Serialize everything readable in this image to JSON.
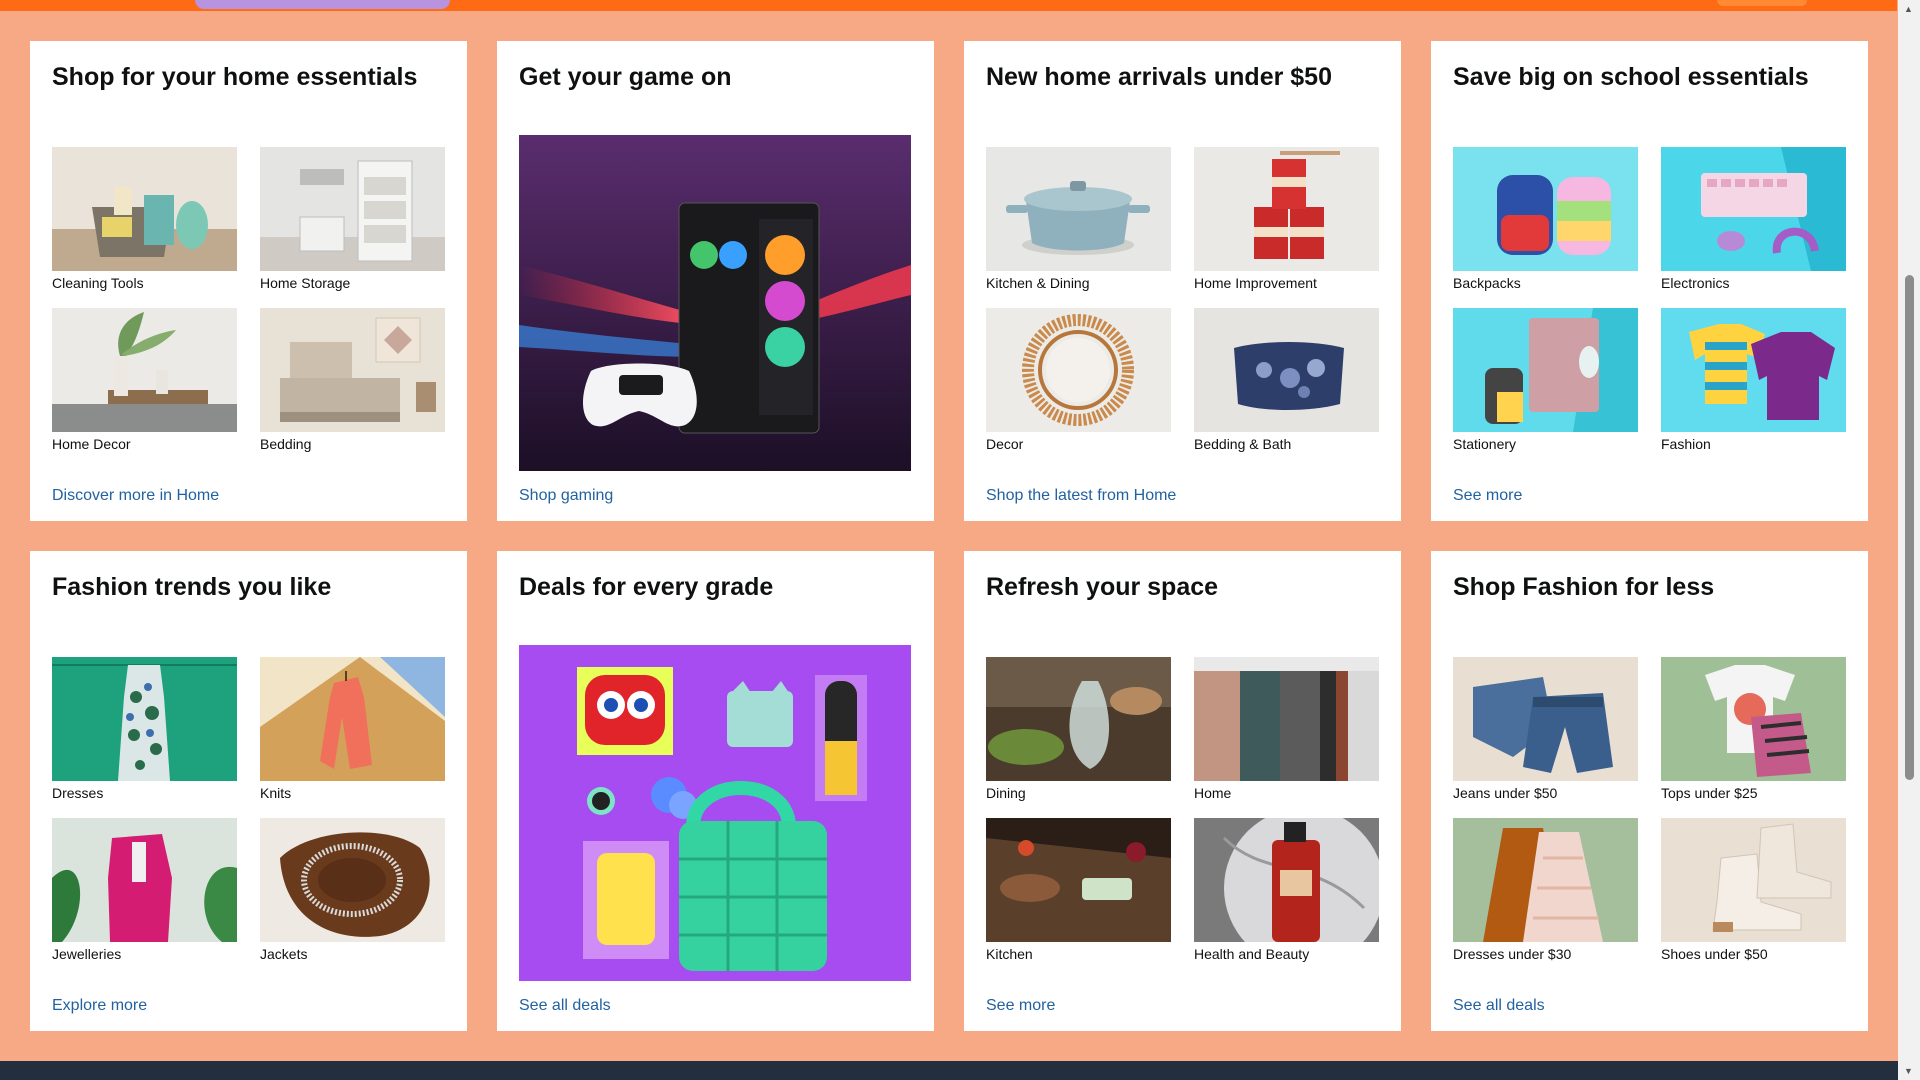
{
  "cards": [
    {
      "title": "Shop for your home essentials",
      "items": [
        "Cleaning Tools",
        "Home Storage",
        "Home Decor",
        "Bedding"
      ],
      "link": "Discover more in Home"
    },
    {
      "title": "Get your game on",
      "link": "Shop gaming"
    },
    {
      "title": "New home arrivals under $50",
      "items": [
        "Kitchen & Dining",
        "Home Improvement",
        "Decor",
        "Bedding & Bath"
      ],
      "link": "Shop the latest from Home"
    },
    {
      "title": "Save big on school essentials",
      "items": [
        "Backpacks",
        "Electronics",
        "Stationery",
        "Fashion"
      ],
      "link": "See more"
    },
    {
      "title": "Fashion trends you like",
      "items": [
        "Dresses",
        "Knits",
        "Jewelleries",
        "Jackets"
      ],
      "link": "Explore more"
    },
    {
      "title": "Deals for every grade",
      "link": "See all deals"
    },
    {
      "title": "Refresh your space",
      "items": [
        "Dining",
        "Home",
        "Kitchen",
        "Health and Beauty"
      ],
      "link": "See more"
    },
    {
      "title": "Shop Fashion for less",
      "items": [
        "Jeans under $50",
        "Tops under $25",
        "Dresses under $30",
        "Shoes under $50"
      ],
      "link": "See all deals"
    }
  ],
  "colors": {
    "page_background": "#f7a985",
    "top_band": "#ff6a14",
    "link": "#2162a1",
    "footer": "#232f3e"
  }
}
